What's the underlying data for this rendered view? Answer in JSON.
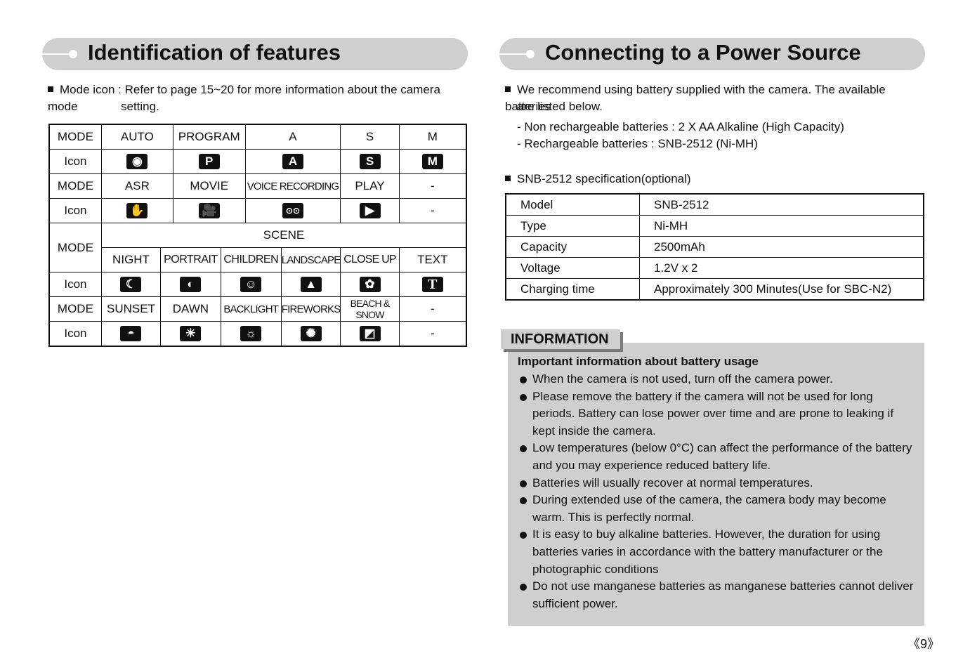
{
  "left": {
    "title": "Identification of features",
    "intro_line1": "Mode icon : Refer to page 15~20 for more information about the camera mode",
    "intro_line2": "setting.",
    "table": {
      "row1": {
        "label": "MODE",
        "cells": [
          "AUTO",
          "PROGRAM",
          "A",
          "S",
          "M"
        ]
      },
      "row2": {
        "label": "Icon",
        "icons": [
          "auto-camera-icon",
          "program-camera-icon",
          "aperture-a-icon",
          "shutter-s-icon",
          "manual-m-icon"
        ],
        "glyphs": [
          "◉",
          "P",
          "A",
          "S",
          "M"
        ]
      },
      "row3": {
        "label": "MODE",
        "cells": [
          "ASR",
          "MOVIE",
          "VOICE RECORDING",
          "PLAY",
          "-"
        ]
      },
      "row4": {
        "label": "Icon",
        "icons": [
          "asr-hand-icon",
          "movie-camera-icon",
          "voice-recording-tape-icon",
          "play-icon"
        ],
        "glyphs": [
          "✋",
          "🎥",
          "⊙⊙",
          "▶"
        ],
        "last": "-"
      },
      "scene_label": "SCENE",
      "scene_mode_label": "MODE",
      "row5": {
        "cells": [
          "NIGHT",
          "PORTRAIT",
          "CHILDREN",
          "LANDSCAPE",
          "CLOSE UP",
          "TEXT"
        ]
      },
      "row6": {
        "label": "Icon",
        "icons": [
          "night-moon-icon",
          "portrait-icon",
          "children-icon",
          "landscape-mountain-icon",
          "close-up-flower-icon",
          "text-t-icon"
        ],
        "glyphs": [
          "☾",
          "◐",
          "☺",
          "▲",
          "✿",
          "T"
        ]
      },
      "row7": {
        "label": "MODE",
        "cells": [
          "SUNSET",
          "DAWN",
          "BACKLIGHT",
          "FIREWORKS",
          "BEACH & SNOW",
          "-"
        ]
      },
      "row8": {
        "label": "Icon",
        "icons": [
          "sunset-icon",
          "dawn-icon",
          "backlight-icon",
          "fireworks-icon",
          "beach-snow-icon"
        ],
        "glyphs": [
          "◓",
          "☀",
          "☼",
          "✺",
          "◩"
        ],
        "last": "-"
      }
    }
  },
  "right": {
    "title": "Connecting to a Power Source",
    "intro_line1": "We recommend using battery supplied with the camera. The available batteries",
    "intro_line2": "are listed below.",
    "battery_non_rechargeable": "- Non rechargeable batteries : 2 X AA Alkaline (High Capacity)",
    "battery_rechargeable": "- Rechargeable batteries : SNB-2512 (Ni-MH)",
    "spec_heading": "SNB-2512 specification(optional)",
    "spec": [
      {
        "key": "Model",
        "value": "SNB-2512"
      },
      {
        "key": "Type",
        "value": "Ni-MH"
      },
      {
        "key": "Capacity",
        "value": "2500mAh"
      },
      {
        "key": "Voltage",
        "value": "1.2V x 2"
      },
      {
        "key": "Charging time",
        "value": "Approximately 300 Minutes(Use for SBC-N2)"
      }
    ],
    "info": {
      "tab_label": "INFORMATION",
      "heading": "Important information about battery usage",
      "items": [
        "When the camera is not used, turn off the camera power.",
        "Please remove the battery if the camera will not be used for long periods. Battery can lose power over time and are prone to leaking if kept inside the camera.",
        "Low temperatures (below 0°C) can affect the performance of the battery and you may experience reduced battery life.",
        "Batteries will usually recover at normal temperatures.",
        "During extended use of the camera, the camera body may become warm. This is perfectly normal.",
        "It is easy to buy alkaline batteries. However, the duration for using batteries varies in accordance with the battery manufacturer or the photographic conditions",
        "Do not use manganese batteries as manganese batteries cannot deliver sufficient power."
      ]
    }
  },
  "page_number": "《9》"
}
